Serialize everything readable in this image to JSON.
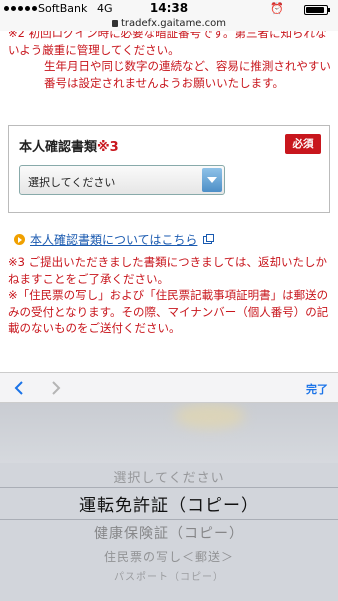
{
  "status_bar": {
    "carrier": "SoftBank",
    "network": "4G",
    "time": "14:38",
    "alarm_icon": "alarm-clock-icon",
    "battery_level": 0.9
  },
  "url_bar": {
    "url": "tradefx.gaitame.com"
  },
  "notice": {
    "line1": "※2 初回ログイン時に必要な暗証番号です。第三者に知られないよう厳重に管理してください。",
    "line2": "生年月日や同じ数字の連続など、容易に推測されやすい番号は設定されませんようお願いいたします。"
  },
  "id_docs": {
    "title": "本人確認書類",
    "mark": "※3",
    "required": "必須",
    "select_value": "選択してください"
  },
  "docs_link": "本人確認書類についてはこちら",
  "note2": {
    "line1": "※3 ご提出いただきました書類につきましては、返却いたしかねますことをご了承ください。",
    "line2": "※「住民票の写し」および「住民票記載事項証明書」は郵送のみの受付となります。その際、マイナンバー（個人番号）の記載のないものをご送付ください。"
  },
  "toolbar": {
    "done": "完了"
  },
  "picker": {
    "options": [
      "選択してください",
      "運転免許証（コピー）",
      "健康保険証（コピー）",
      "住民票の写し＜郵送＞",
      "パスポート（コピー）"
    ],
    "selected_index": 1
  },
  "colors": {
    "accent": "#c8161d",
    "link": "#1a5ab0",
    "done": "#1a73e8"
  }
}
